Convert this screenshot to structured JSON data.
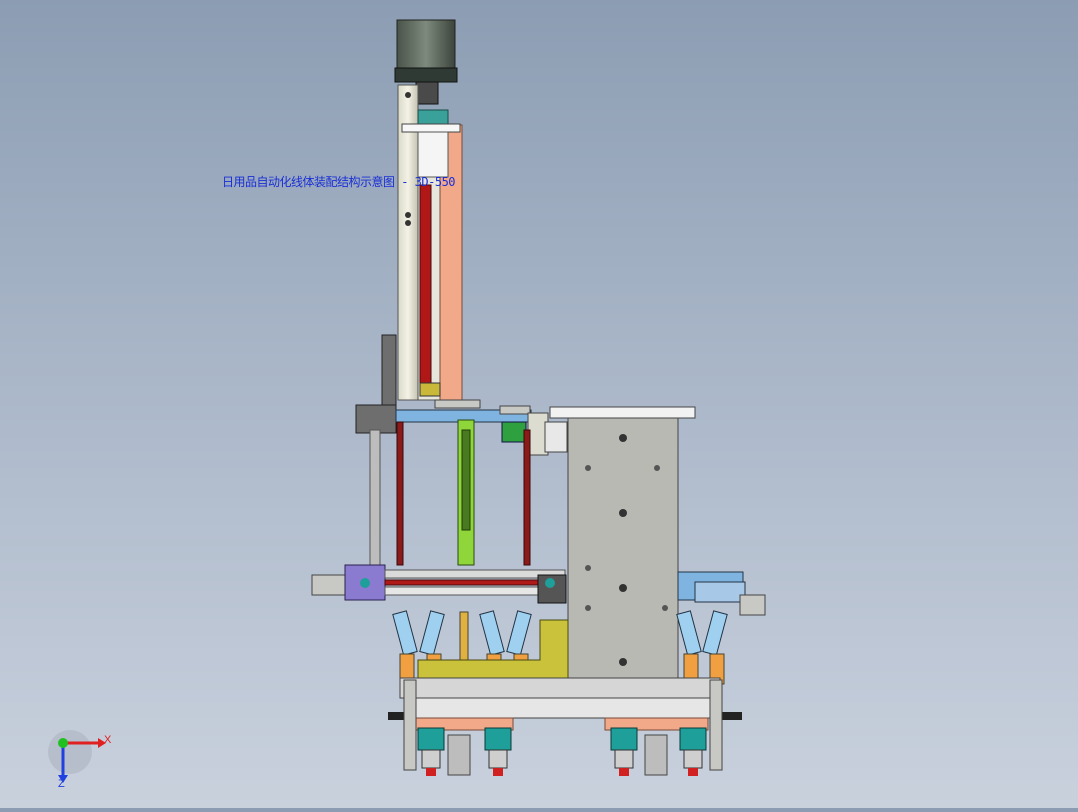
{
  "viewport": {
    "overlay_text": "日用品自动化线体装配结构示意图 - 3D-550",
    "colors": {
      "background_top": "#8c9db3",
      "background_bottom": "#c9d1dd",
      "frame_gray": "#c8c8c4",
      "plate_gray": "#b9b9b3",
      "salmon": "#f1a98a",
      "dark_red": "#8b1a1a",
      "lime": "#8ed63a",
      "olive": "#c9c23a",
      "blue": "#7fb4e0",
      "teal": "#1e9f9a",
      "motor_dark": "#5a6458"
    }
  },
  "triad": {
    "x_label": "X",
    "z_label": "Z",
    "x_color": "#e02020",
    "y_color": "#20c020",
    "z_color": "#2040e0"
  }
}
